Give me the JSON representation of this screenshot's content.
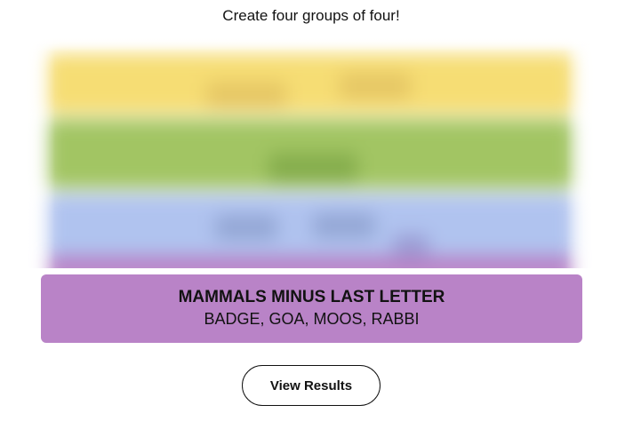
{
  "instructions": "Create four groups of four!",
  "board": {
    "band_colors": [
      "#f6dd74",
      "#a2c563",
      "#b0c3ef",
      "#b983c7"
    ]
  },
  "solved_group": {
    "title": "MAMMALS MINUS LAST LETTER",
    "members": "BADGE, GOA, MOOS, RABBI",
    "color": "#b983c7"
  },
  "actions": {
    "view_results_label": "View Results"
  }
}
